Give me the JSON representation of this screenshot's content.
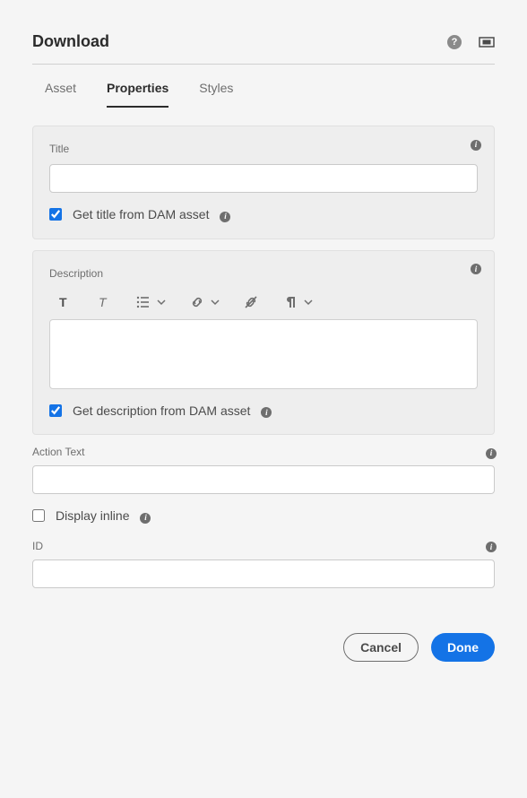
{
  "header": {
    "title": "Download"
  },
  "tabs": {
    "items": [
      {
        "label": "Asset"
      },
      {
        "label": "Properties"
      },
      {
        "label": "Styles"
      }
    ]
  },
  "titleGroup": {
    "label": "Title",
    "value": "",
    "checkboxLabel": "Get title from DAM asset",
    "checked": true
  },
  "descriptionGroup": {
    "label": "Description",
    "value": "",
    "checkboxLabel": "Get description from DAM asset",
    "checked": true
  },
  "actionText": {
    "label": "Action Text",
    "value": ""
  },
  "displayInline": {
    "label": "Display inline",
    "checked": false
  },
  "idField": {
    "label": "ID",
    "value": ""
  },
  "footer": {
    "cancel": "Cancel",
    "done": "Done"
  }
}
